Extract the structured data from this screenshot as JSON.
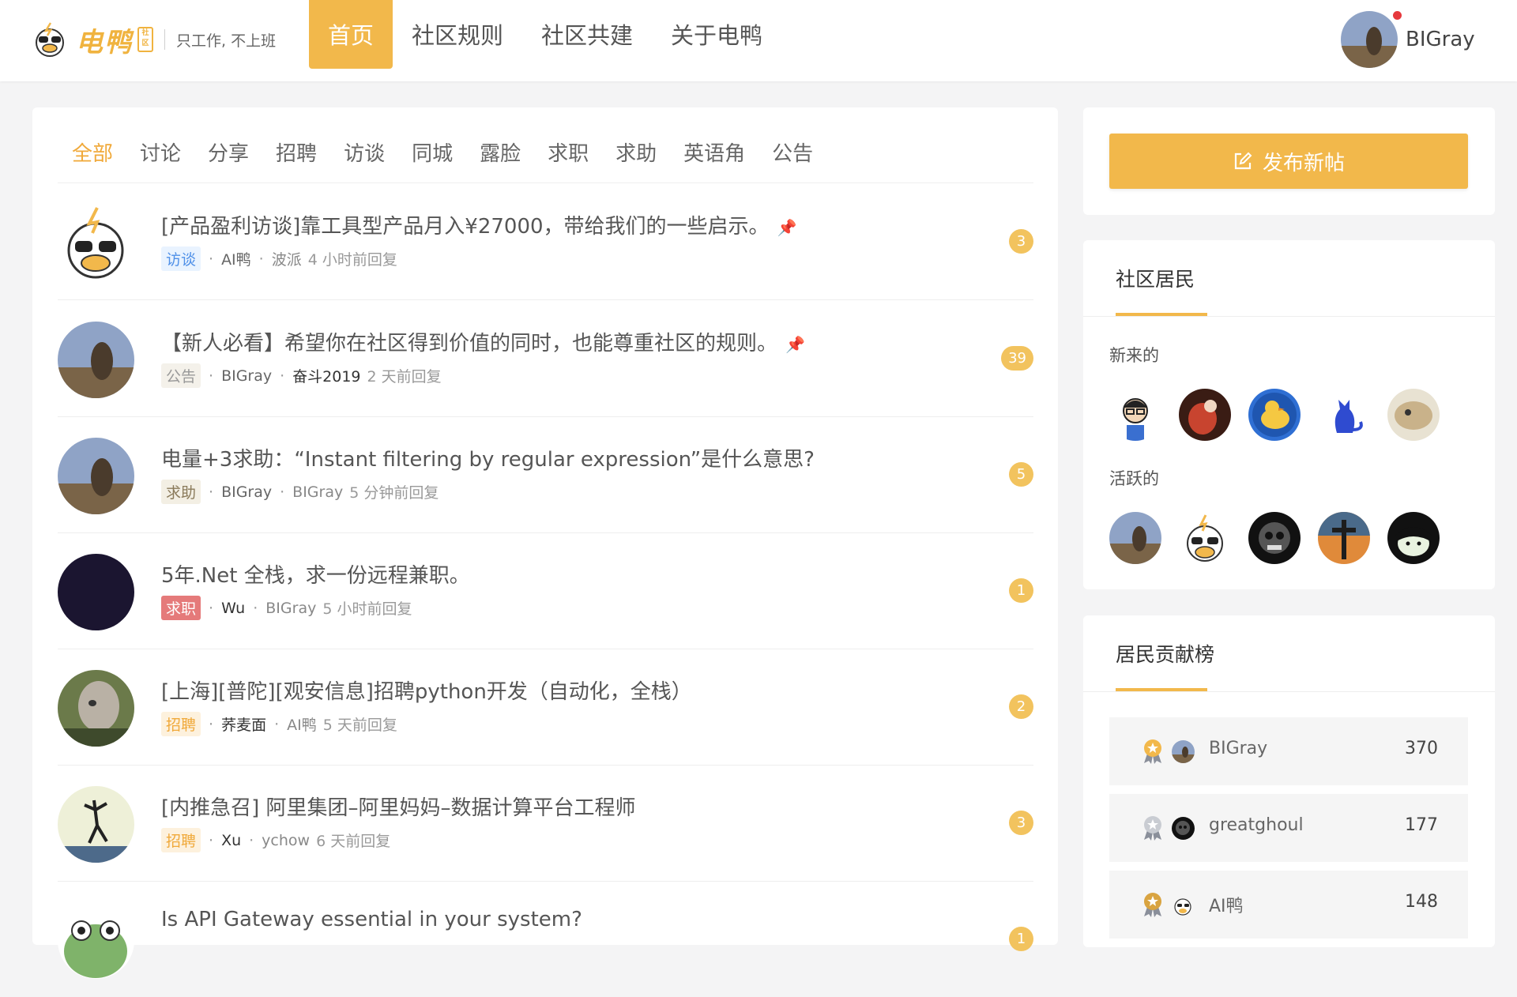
{
  "brand": {
    "name": "电鸭",
    "badge": "社区",
    "slogan": "只工作, 不上班"
  },
  "nav": {
    "items": [
      "首页",
      "社区规则",
      "社区共建",
      "关于电鸭"
    ],
    "active": 0
  },
  "user": {
    "name": "BIGray"
  },
  "tabs": {
    "items": [
      "全部",
      "讨论",
      "分享",
      "招聘",
      "访谈",
      "同城",
      "露脸",
      "求职",
      "求助",
      "英语角",
      "公告"
    ],
    "active": 0
  },
  "topics": [
    {
      "title": "[产品盈利访谈]靠工具型产品月入¥27000，带给我们的一些启示。",
      "pinned": true,
      "tag": "访谈",
      "author": "AI鸭",
      "replier": "波派",
      "time": "4 小时前回复",
      "count": "3"
    },
    {
      "title": "【新人必看】希望你在社区得到价值的同时，也能尊重社区的规则。",
      "pinned": true,
      "tag": "公告",
      "author": "BIGray",
      "replier": "奋斗2019",
      "time": "2 天前回复",
      "count": "39"
    },
    {
      "title": "电量+3求助：“Instant filtering by regular expression”是什么意思?",
      "pinned": false,
      "tag": "求助",
      "author": "BIGray",
      "replier": "BIGray",
      "time": "5 分钟前回复",
      "count": "5"
    },
    {
      "title": "5年.Net 全栈，求一份远程兼职。",
      "pinned": false,
      "tag": "求职",
      "author": "Wu",
      "replier": "BIGray",
      "time": "5 小时前回复",
      "count": "1"
    },
    {
      "title": "[上海][普陀][观安信息]招聘python开发（自动化，全栈）",
      "pinned": false,
      "tag": "招聘",
      "author": "荞麦面",
      "replier": "AI鸭",
      "time": "5 天前回复",
      "count": "2"
    },
    {
      "title": "[内推急召] 阿里集团–阿里妈妈–数据计算平台工程师",
      "pinned": false,
      "tag": "招聘",
      "author": "Xu",
      "replier": "ychow",
      "time": "6 天前回复",
      "count": "3"
    },
    {
      "title": "Is API Gateway essential in your system?",
      "pinned": false,
      "tag": "",
      "author": "",
      "replier": "",
      "time": "",
      "count": "1"
    }
  ],
  "sidebar": {
    "post_button": "发布新帖",
    "residents": {
      "title": "社区居民",
      "newcomers_label": "新来的",
      "active_label": "活跃的"
    },
    "leaderboard": {
      "title": "居民贡献榜",
      "rows": [
        {
          "name": "BIGray",
          "score": "370",
          "medal": "gold"
        },
        {
          "name": "greatghoul",
          "score": "177",
          "medal": "silver"
        },
        {
          "name": "AI鸭",
          "score": "148",
          "medal": "bronze"
        }
      ]
    }
  },
  "colors": {
    "accent": "#f2b84b",
    "tag_blue": "#4f90e8",
    "tag_red": "#e57a7a"
  }
}
